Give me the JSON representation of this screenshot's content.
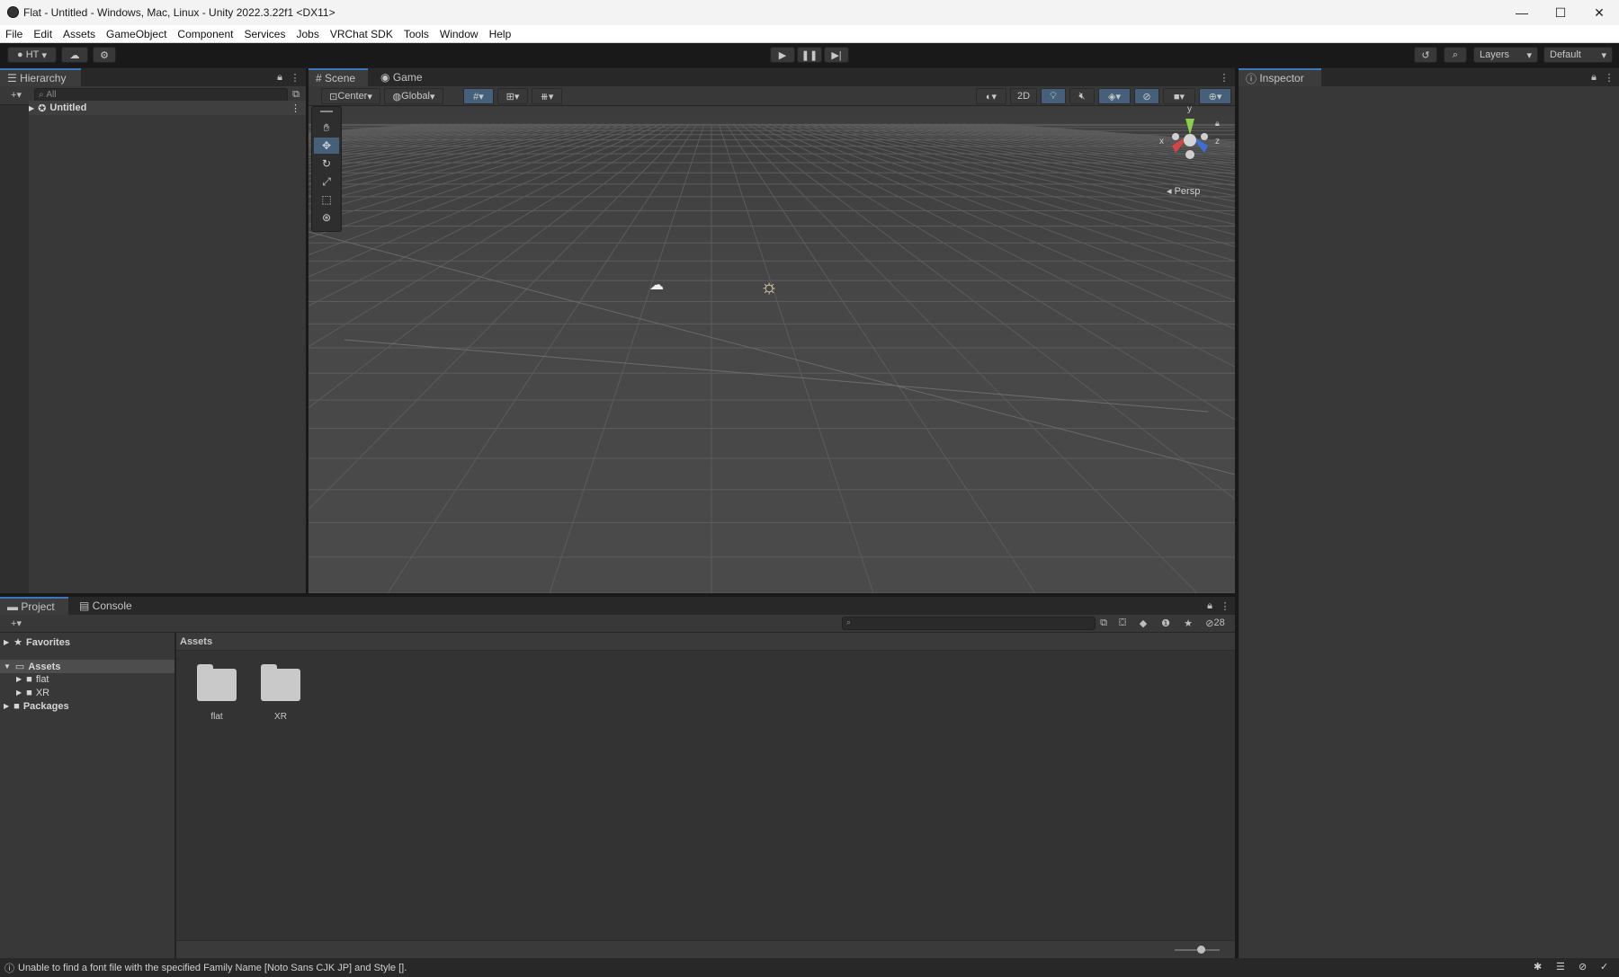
{
  "window": {
    "title": "Flat - Untitled - Windows, Mac, Linux - Unity 2022.3.22f1 <DX11>",
    "minimize": "—",
    "maximize": "☐",
    "close": "✕"
  },
  "menu": [
    "File",
    "Edit",
    "Assets",
    "GameObject",
    "Component",
    "Services",
    "Jobs",
    "VRChat SDK",
    "Tools",
    "Window",
    "Help"
  ],
  "toolbar": {
    "account_label": "HT",
    "layers_label": "Layers",
    "layout_label": "Default"
  },
  "hierarchy": {
    "tab_label": "Hierarchy",
    "search_placeholder": "All",
    "scene_name": "Untitled"
  },
  "scene": {
    "tab_scene": "Scene",
    "tab_game": "Game",
    "pivot_label": "Center",
    "space_label": "Global",
    "mode_2d": "2D",
    "persp_label": "◂ Persp",
    "gizmo_y": "y",
    "gizmo_x": "x",
    "gizmo_z": "z"
  },
  "inspector": {
    "tab_label": "Inspector"
  },
  "project": {
    "tab_project": "Project",
    "tab_console": "Console",
    "hidden_count": "28",
    "favorites_label": "Favorites",
    "assets_label": "Assets",
    "tree": [
      "flat",
      "XR"
    ],
    "packages_label": "Packages",
    "breadcrumb": "Assets",
    "folders": [
      "flat",
      "XR"
    ]
  },
  "status": {
    "message": "Unable to find a font file with the specified Family Name [Noto Sans CJK JP] and Style []."
  },
  "colors": {
    "selection_blue": "#3a79bb",
    "panel_bg": "#383838",
    "scene_bg": "#474747"
  }
}
